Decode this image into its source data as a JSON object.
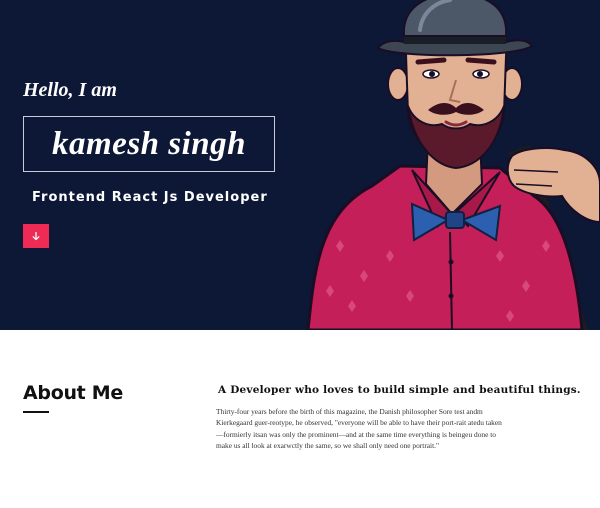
{
  "hero": {
    "greeting": "Hello, I am",
    "name": "kamesh singh",
    "role": "Frontend React Js Developer",
    "scroll_icon": "arrow-down-icon",
    "accent_color": "#ee2a55",
    "background_color": "#0d1736"
  },
  "about": {
    "title": "About Me",
    "headline": "A Developer who loves to build simple and beautiful things.",
    "body": "Thirty-four years before the birth of this magazine, the Danish philosopher Sore test andm Kierkegaard guer-reotype, he observed, \"everyone will be able to have their port-rait atedu taken—formierly itsan was only the prominent—and at the same time everything is beingeu done to make us all look at exarwctly the same, so we shall only need one portrait.\""
  }
}
